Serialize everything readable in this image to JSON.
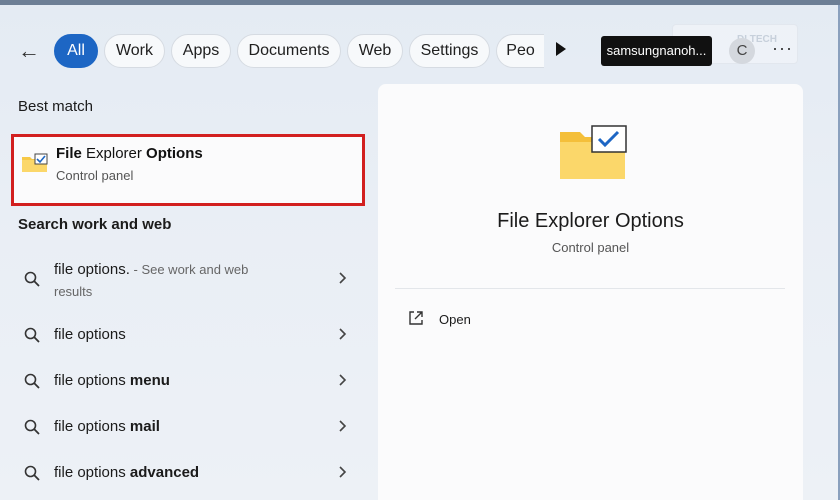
{
  "filters": {
    "tabs": [
      {
        "label": "All",
        "active": true
      },
      {
        "label": "Work",
        "active": false
      },
      {
        "label": "Apps",
        "active": false
      },
      {
        "label": "Documents",
        "active": false
      },
      {
        "label": "Web",
        "active": false
      },
      {
        "label": "Settings",
        "active": false
      },
      {
        "label": "Peo",
        "active": false
      }
    ],
    "account_label": "samsungnanoh...",
    "avatar_letter": "C",
    "more_label": "···",
    "watermark_text": "DI TECH"
  },
  "best_match": {
    "heading": "Best match",
    "title_part1": "File",
    "title_part2": " Explorer ",
    "title_part3": "Options",
    "subtitle": "Control panel"
  },
  "search_web": {
    "heading": "Search work and web",
    "results": [
      {
        "text_plain": "file options.",
        "hint": " - See work and web",
        "hint2": "results"
      },
      {
        "text_plain": "file options",
        "bold": ""
      },
      {
        "text_plain": "file options ",
        "bold": "menu"
      },
      {
        "text_plain": "file options ",
        "bold": "mail"
      },
      {
        "text_plain": "file options ",
        "bold": "advanced"
      }
    ]
  },
  "preview": {
    "title": "File Explorer Options",
    "subtitle": "Control panel",
    "actions": [
      {
        "label": "Open",
        "icon": "open-external-icon"
      }
    ]
  },
  "colors": {
    "accent": "#1d66c4",
    "highlight_border": "#d21f1f",
    "folder": "#f7c948"
  }
}
